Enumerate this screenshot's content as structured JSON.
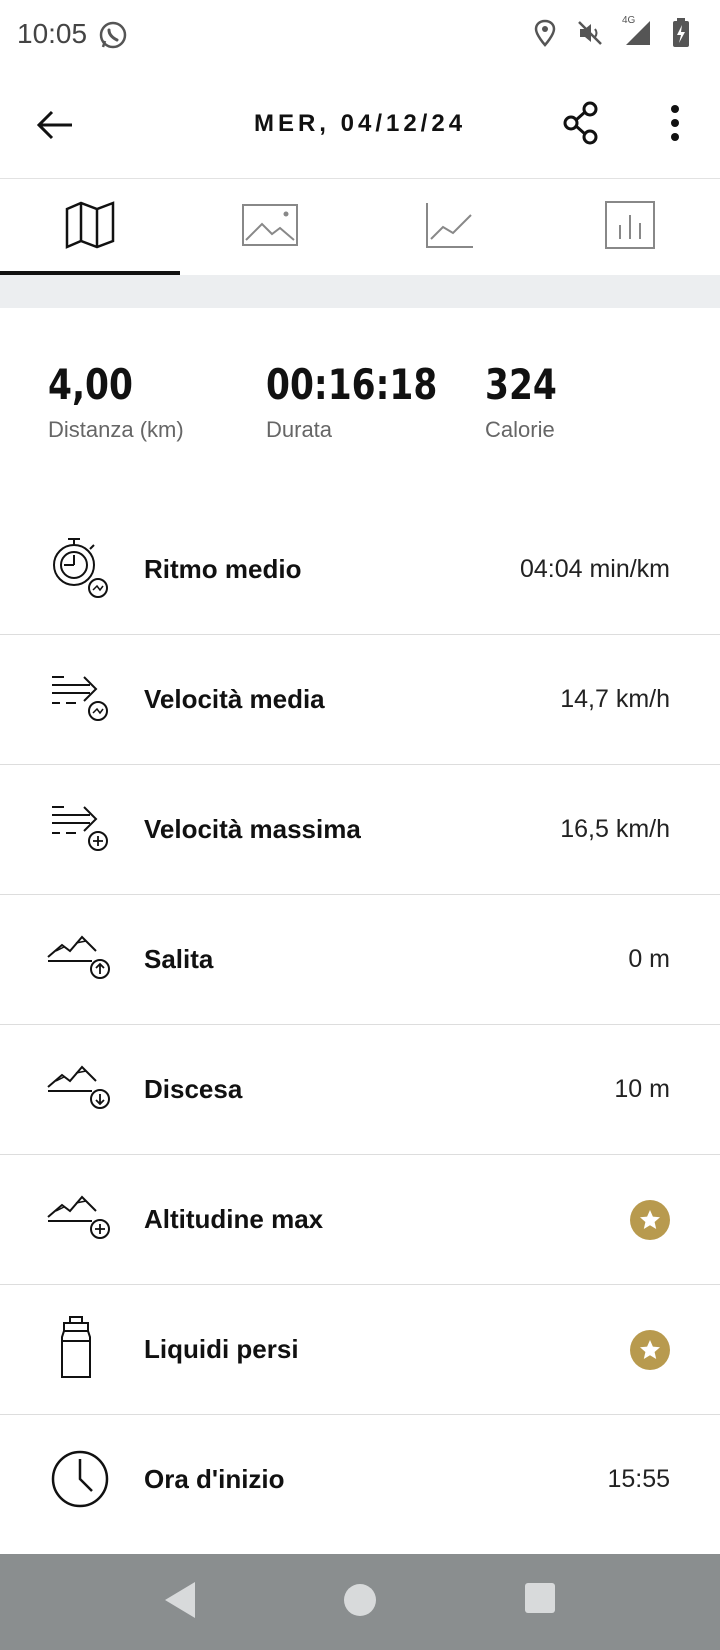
{
  "status_bar": {
    "time": "10:05",
    "icons": [
      "whatsapp-icon",
      "location-icon",
      "mute-icon",
      "signal-4g-icon",
      "battery-charging-icon"
    ],
    "network_label": "4G"
  },
  "app_bar": {
    "title": "MER, 04/12/24",
    "icons": [
      "back-arrow-icon",
      "share-icon",
      "more-vert-icon"
    ]
  },
  "tabs": [
    {
      "icon": "map-icon",
      "active": true
    },
    {
      "icon": "image-icon",
      "active": false
    },
    {
      "icon": "line-chart-icon",
      "active": false
    },
    {
      "icon": "bar-chart-icon",
      "active": false
    }
  ],
  "summary": [
    {
      "value": "4,00",
      "label": "Distanza (km)"
    },
    {
      "value": "00:16:18",
      "label": "Durata"
    },
    {
      "value": "324",
      "label": "Calorie"
    }
  ],
  "stats": [
    {
      "icon": "stopwatch-pace-icon",
      "label": "Ritmo medio",
      "value": "04:04 min/km"
    },
    {
      "icon": "speed-average-icon",
      "label": "Velocità media",
      "value": "14,7 km/h"
    },
    {
      "icon": "speed-max-icon",
      "label": "Velocità massima",
      "value": "16,5 km/h"
    },
    {
      "icon": "ascent-icon",
      "label": "Salita",
      "value": "0 m"
    },
    {
      "icon": "descent-icon",
      "label": "Discesa",
      "value": "10 m"
    },
    {
      "icon": "altitude-max-icon",
      "label": "Altitudine max",
      "value": "",
      "premium_icon": "star-icon"
    },
    {
      "icon": "water-bottle-icon",
      "label": "Liquidi persi",
      "value": "",
      "premium_icon": "star-icon"
    },
    {
      "icon": "clock-icon",
      "label": "Ora d'inizio",
      "value": "15:55"
    }
  ],
  "colors": {
    "premium_star_bg": "#b89a4e",
    "nav_bar_bg": "#8a8e8f",
    "tab_divider_band": "#eceef0",
    "active_tab_indicator": "#111111"
  },
  "nav_bar": {
    "icons": [
      "nav-back-icon",
      "nav-home-icon",
      "nav-recents-icon"
    ]
  }
}
